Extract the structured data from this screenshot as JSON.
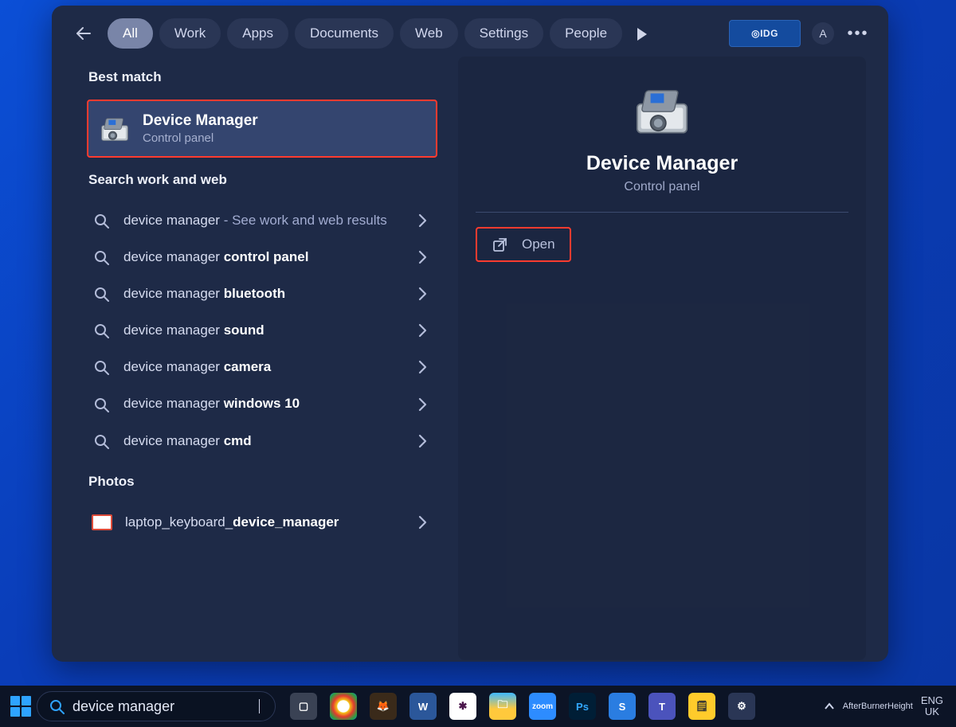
{
  "filters": {
    "all": "All",
    "work": "Work",
    "apps": "Apps",
    "documents": "Documents",
    "web": "Web",
    "settings": "Settings",
    "people": "People"
  },
  "idg_label": "◎IDG",
  "avatar_letter": "A",
  "sections": {
    "best_match": "Best match",
    "search_web": "Search work and web",
    "photos": "Photos"
  },
  "best": {
    "title": "Device Manager",
    "subtitle": "Control panel"
  },
  "web_results": [
    {
      "prefix": "device manager",
      "suffix": " - See work and web results",
      "bold": ""
    },
    {
      "prefix": "device manager ",
      "bold": "control panel"
    },
    {
      "prefix": "device manager ",
      "bold": "bluetooth"
    },
    {
      "prefix": "device manager ",
      "bold": "sound"
    },
    {
      "prefix": "device manager ",
      "bold": "camera"
    },
    {
      "prefix": "device manager ",
      "bold": "windows 10"
    },
    {
      "prefix": "device manager ",
      "bold": "cmd"
    }
  ],
  "photos_row": {
    "prefix": "laptop_keyboard_",
    "bold": "device_manager"
  },
  "detail": {
    "title": "Device Manager",
    "subtitle": "Control panel",
    "open": "Open"
  },
  "search_value": "device manager",
  "tray": {
    "overlay": "AfterBurnerHeight",
    "lang1": "ENG",
    "lang2": "UK"
  }
}
